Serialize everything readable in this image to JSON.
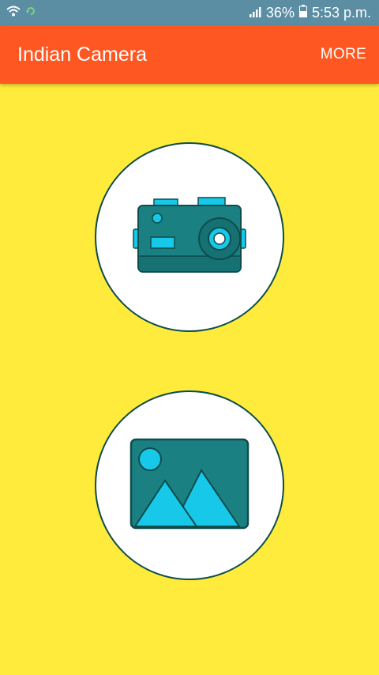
{
  "status_bar": {
    "battery": "36%",
    "time": "5:53 p.m."
  },
  "app_bar": {
    "title": "Indian Camera",
    "more_label": "MORE"
  },
  "buttons": {
    "camera_icon": "camera-icon",
    "gallery_icon": "gallery-icon"
  },
  "colors": {
    "background": "#FFEB3B",
    "app_bar": "#FF5722",
    "status_bar": "#5B8DA3",
    "icon_teal": "#1A8082",
    "icon_cyan": "#17C8E8",
    "outline": "#0F4C4C"
  }
}
